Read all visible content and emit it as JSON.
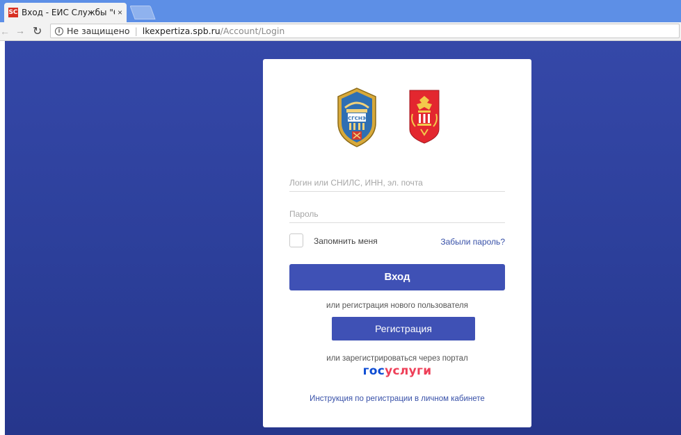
{
  "browser": {
    "tab_title": "Вход - ЕИС Службы \"Стр",
    "favicon_text": "SC",
    "tab_close": "×",
    "security_text": "Не защищено",
    "url_host": "lkexpertiza.spb.ru",
    "url_path": "/Account/Login"
  },
  "colors": {
    "accent": "#3f51b5",
    "background_top": "#3548a8",
    "background_bottom": "#26368c",
    "gosuslugi_blue": "#0d4cd3",
    "gosuslugi_red": "#ee3f58"
  },
  "form": {
    "login_placeholder": "Логин или СНИЛС, ИНН, эл. почта",
    "password_placeholder": "Пароль",
    "remember_label": "Запомнить меня",
    "forgot_link": "Забыли пароль?",
    "login_button": "Вход",
    "or_register_text": "или регистрация нового пользователя",
    "register_button": "Регистрация",
    "or_portal_text": "или зарегистрироваться через портал",
    "gosuslugi_part1": "гос",
    "gosuslugi_part2": "услуги",
    "instruction_link": "Инструкция по регистрации в личном кабинете"
  },
  "emblems": {
    "left": {
      "icon": "sgsn-emblem-icon",
      "text": "СГСНЭ"
    },
    "right": {
      "icon": "coat-of-arms-icon"
    }
  }
}
